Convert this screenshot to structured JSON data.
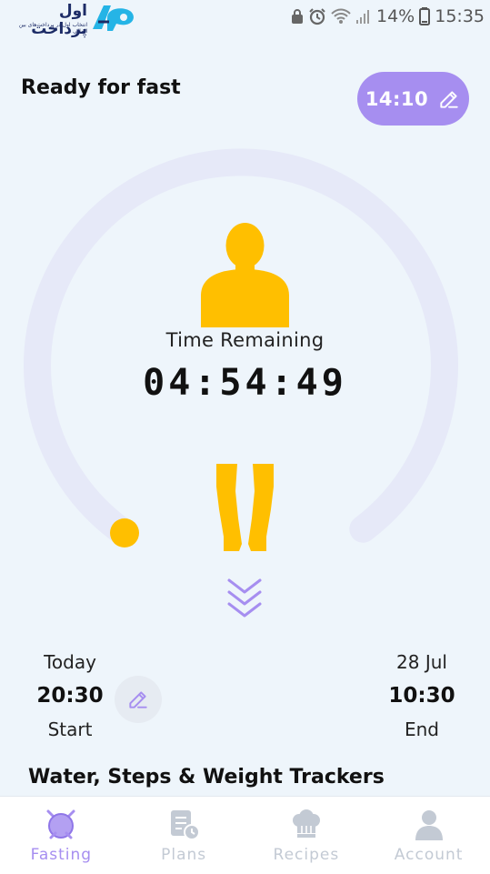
{
  "status_bar": {
    "logo_text": "اول پرداخت",
    "logo_subtext": "انتخاب اول در پرداخت‌های بین المللی",
    "battery": "14%",
    "time": "15:35",
    "icons": [
      "lock-icon",
      "alarm-icon",
      "wifi-icon",
      "signal-icon",
      "battery-icon"
    ]
  },
  "header": {
    "title": "Ready for fast",
    "target_hours": "14:10"
  },
  "timer": {
    "label": "Time Remaining",
    "value": "04:54:49",
    "progress_fraction": 0.0
  },
  "schedule": {
    "start": {
      "day": "Today",
      "time": "20:30",
      "label": "Start"
    },
    "end": {
      "day": "28 Jul",
      "time": "10:30",
      "label": "End"
    }
  },
  "trackers": {
    "heading": "Water, Steps & Weight Trackers"
  },
  "bottom_nav": {
    "items": [
      {
        "label": "Fasting",
        "icon": "fasting-icon",
        "active": true
      },
      {
        "label": "Plans",
        "icon": "plans-icon",
        "active": false
      },
      {
        "label": "Recipes",
        "icon": "chef-hat-icon",
        "active": false
      },
      {
        "label": "Account",
        "icon": "account-icon",
        "active": false
      }
    ]
  },
  "colors": {
    "accent": "#a68ef0",
    "body_fill": "#ffbf00",
    "ring_track": "#e6e9f8",
    "background": "#eef5fb"
  }
}
